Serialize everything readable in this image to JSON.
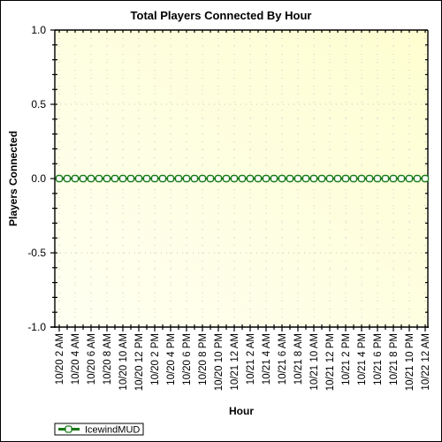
{
  "chart_data": {
    "type": "line",
    "title": "Total Players Connected By Hour",
    "xlabel": "Hour",
    "ylabel": "Players Connected",
    "ylim": [
      -1.0,
      1.0
    ],
    "y_ticks": [
      {
        "value": 1.0,
        "label": "1.0"
      },
      {
        "value": 0.5,
        "label": "0.5"
      },
      {
        "value": 0.0,
        "label": "0.0"
      },
      {
        "value": -0.5,
        "label": "-0.5"
      },
      {
        "value": -1.0,
        "label": "-1.0"
      }
    ],
    "x_tick_labels": [
      "10/20 2 AM",
      "10/20 4 AM",
      "10/20 6 AM",
      "10/20 8 AM",
      "10/20 10 AM",
      "10/20 12 PM",
      "10/20 2 PM",
      "10/20 4 PM",
      "10/20 6 PM",
      "10/20 8 PM",
      "10/20 10 PM",
      "10/21 12 AM",
      "10/21 2 AM",
      "10/21 4 AM",
      "10/21 6 AM",
      "10/21 8 AM",
      "10/21 10 AM",
      "10/21 12 PM",
      "10/21 2 PM",
      "10/21 4 PM",
      "10/21 6 PM",
      "10/21 8 PM",
      "10/21 10 PM",
      "10/22 12 AM"
    ],
    "x_range_hours": [
      0,
      46
    ],
    "x_start": "10/20 2 AM",
    "x_step_hours": 1,
    "grid": true,
    "legend_position": "bottom-left",
    "series": [
      {
        "name": "IcewindMUD",
        "color": "#1a7a1a",
        "marker": "circle-open",
        "values": [
          0,
          0,
          0,
          0,
          0,
          0,
          0,
          0,
          0,
          0,
          0,
          0,
          0,
          0,
          0,
          0,
          0,
          0,
          0,
          0,
          0,
          0,
          0,
          0,
          0,
          0,
          0,
          0,
          0,
          0,
          0,
          0,
          0,
          0,
          0,
          0,
          0,
          0,
          0,
          0,
          0,
          0,
          0,
          0,
          0,
          0,
          0
        ]
      }
    ],
    "plot_background": {
      "top_right": "#fefed0",
      "bottom_left": "#fffff2"
    }
  }
}
